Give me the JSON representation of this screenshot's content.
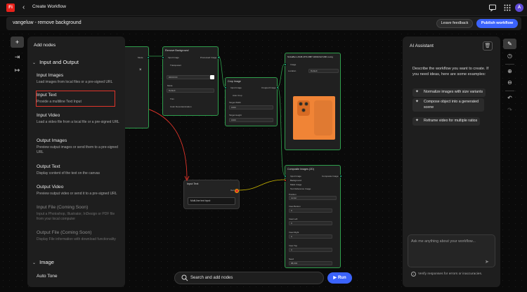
{
  "topbar": {
    "app_logo": "Fi",
    "title": "Create Workflow",
    "avatar_initials": "A"
  },
  "subbar": {
    "workflow_name": "vangeluw - remove background",
    "leave_feedback": "Leave feedback",
    "publish_workflow": "Publish workflow"
  },
  "add_nodes": {
    "title": "Add nodes",
    "sections": [
      {
        "label": "Input and Output",
        "items": [
          {
            "title": "Input Images",
            "desc": "Load images from local files or a pre-signed URL"
          },
          {
            "title": "Input Text",
            "desc": "Provide a multiline Text Input"
          },
          {
            "title": "Input Video",
            "desc": "Load a video file from a local file or a pre-signed URL"
          },
          {
            "title": "Output Images",
            "desc": "Preview output images or send them to a pre-signed URL"
          },
          {
            "title": "Output Text",
            "desc": "Display content of the text on the canvas"
          },
          {
            "title": "Output Video",
            "desc": "Preview output video or send it to a pre-signed URL"
          },
          {
            "title": "Input File (Coming Soon)",
            "desc": "Input a Photoshop, Illustrator, InDesign or PDF file from your local computer"
          },
          {
            "title": "Output File (Coming Soon)",
            "desc": "Display File information with download functionality"
          }
        ]
      },
      {
        "label": "Image",
        "items": [
          {
            "title": "Auto Tone"
          }
        ]
      }
    ]
  },
  "canvas": {
    "remove_bg_node": {
      "title": "Remove Background",
      "input_image": "Input Image",
      "processed_image": "Processed Image",
      "transparent": "Transparent",
      "mode": "Mode",
      "mode_value": "Default",
      "trim": "Trim",
      "color_decontamination": "Color Decontamination",
      "hex_placeholder": "#FFFFFF"
    },
    "crop_node": {
      "title": "Crop Image",
      "input_image": "Input Image",
      "cropped_image": "Cropped Image",
      "auto_crop": "Auto Crop",
      "target_width": "Target Width",
      "target_width_value": "1600",
      "target_height": "Target Height",
      "target_height_value": "1600"
    },
    "preview_node": {
      "title": "NickaBum-4948-4f73-b887-9461b6a7139f-no-bg",
      "image": "Image",
      "location": "Location",
      "location_value": "Default"
    },
    "composite_node": {
      "title": "Composite Images (2D)",
      "input_image": "Input Image",
      "composite_image": "Composite Image",
      "background": "Background",
      "mask_image": "Mask Image",
      "text_reference": "Text Reference Image",
      "position": "Position",
      "position_value": "center",
      "inset_bottom": "Inset Bottom",
      "inset_left": "Inset Left",
      "inset_right": "Inset Right",
      "inset_top": "Inset Top",
      "seed": "Seed",
      "zero": "0",
      "seed_value": "88,004"
    },
    "input_text_node": {
      "title": "Input Text",
      "port_label": "Text",
      "placeholder": "Multi-line text input"
    }
  },
  "bottom": {
    "search_placeholder": "Search and add nodes",
    "run": "Run"
  },
  "ai_assistant": {
    "title": "AI Assistant",
    "description": "Describe the workflow you want to create. If you need ideas, here are some examples:",
    "suggestions": [
      "Normalize images with size variants",
      "Compose object into a generated scene",
      "Reframe video for multiple ratios"
    ],
    "input_placeholder": "Ask me anything about your workflow...",
    "verify_note": "Verify responses for errors or inaccuracies."
  },
  "colors": {
    "accent": "#3b63fb",
    "node_border": "#2f9e4c",
    "highlight": "#e0342a",
    "port": "#1fc28f"
  }
}
